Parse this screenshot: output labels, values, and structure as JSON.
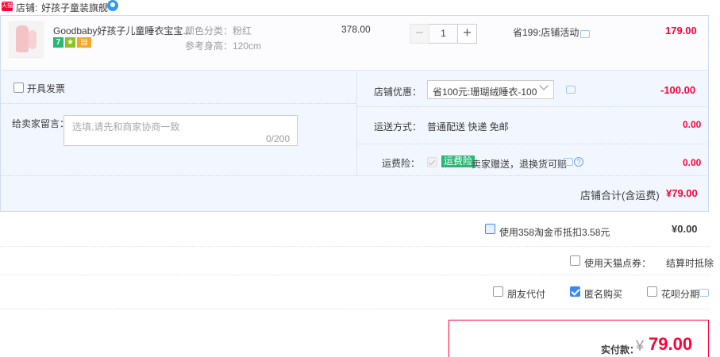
{
  "shop": {
    "badge": "天猫",
    "label": "店铺:",
    "name": "好孩子童装旗舰"
  },
  "item": {
    "title": "Goodbaby好孩子儿童睡衣宝宝...",
    "services": [
      "7",
      "",
      ""
    ],
    "sku_color": "颜色分类：粉红",
    "sku_height": "参考身高：120cm",
    "unit_price": "378.00",
    "qty_minus": "−",
    "quantity": "1",
    "qty_plus": "+",
    "promo": "省199:店铺活动",
    "total": "179.00"
  },
  "options": {
    "invoice_label": "开具发票",
    "message_label": "给卖家留言：",
    "message_placeholder": "选填,请先和商家协商一致",
    "message_count": "0/200",
    "coupon_label": "店铺优惠：",
    "coupon_selected": "省100元:珊瑚绒睡衣-100",
    "coupon_amount": "-100.00",
    "shipping_label": "运送方式：",
    "shipping_value": "普通配送 快递 免邮",
    "shipping_amount": "0.00",
    "insurance_label": "运费险：",
    "insurance_tag": "运费险",
    "insurance_text": "卖家赠送，退换货可赔",
    "insurance_amount": "0.00",
    "help": "?"
  },
  "shop_total": {
    "label": "店铺合计(含运费)",
    "amount": "¥79.00"
  },
  "extras": {
    "coin_label": "使用358淘金币抵扣3.58元",
    "coin_amount": "¥0.00",
    "points_label": "使用天猫点券：",
    "points_value": "结算时抵除",
    "friend_label": "朋友代付",
    "anon_label": "匿名购买",
    "anon_checked": true,
    "huabei_label": "花呗分期"
  },
  "payment": {
    "label": "实付款：",
    "yen": "¥",
    "amount": "79.00"
  },
  "colors": {
    "accent_red": "#ff0036",
    "panel_blue": "#f2f7ff",
    "check_blue": "#3c89f5",
    "tag_green": "#2bb673"
  }
}
